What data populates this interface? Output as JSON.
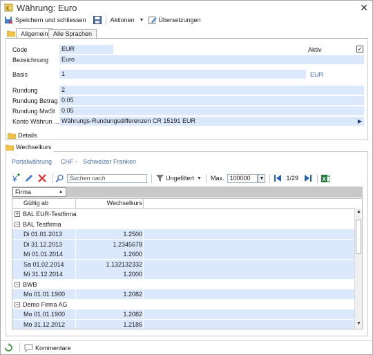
{
  "window": {
    "title": "Währung: Euro"
  },
  "toolbar": {
    "save_close": "Speichern und schliessen",
    "actions": "Aktionen",
    "translations": "Übersetzungen"
  },
  "tabs": [
    {
      "label": "Allgemein"
    },
    {
      "label": "Alle Sprachen"
    }
  ],
  "form": {
    "code_label": "Code",
    "code_value": "EUR",
    "aktiv_label": "Aktiv",
    "aktiv_checked": true,
    "aktiv_check": "✓",
    "bezeichnung_label": "Bezeichnung",
    "bezeichnung_value": "Euro",
    "basis_label": "Basis",
    "basis_value": "1",
    "basis_unit": "EUR",
    "rundung_label": "Rundung",
    "rundung_value": "2",
    "rundung_betrag_label": "Rundung Betrag",
    "rundung_betrag_value": "0.05",
    "rundung_mwst_label": "Rundung MwSt",
    "rundung_mwst_value": "0.05",
    "konto_label": "Konto Währun ...",
    "konto_value": "Währungs-Rundungsdifferenzen CR 15191 EUR"
  },
  "details": {
    "label": "Details"
  },
  "wechselkurs": {
    "tab_label": "Wechselkurs",
    "portal_label": "Portalwährung",
    "portal_code": "CHF",
    "portal_sep": "-",
    "portal_name": "Schweizer Franken",
    "search_placeholder": "Suchen nach",
    "filter_label": "Ungefiltert",
    "max_label": "Max.",
    "max_value": "100000",
    "page": "1/29",
    "group_chip": "Firma",
    "col_gueltig": "Gültig ab",
    "col_kurs": "Wechselkurs",
    "rows": [
      {
        "kind": "group",
        "toggle": "+",
        "text": "BAL EUR-Testfirma"
      },
      {
        "kind": "group",
        "toggle": "−",
        "text": "BAL Testfirma"
      },
      {
        "kind": "data",
        "date": "Di 01.01.2013",
        "rate": "1.2500"
      },
      {
        "kind": "data",
        "date": "Di 31.12.2013",
        "rate": "1.2345678"
      },
      {
        "kind": "data",
        "date": "Mi 01.01.2014",
        "rate": "1.2600"
      },
      {
        "kind": "data",
        "date": "Sa 01.02.2014",
        "rate": "1.132132332"
      },
      {
        "kind": "data",
        "date": "Mi 31.12.2014",
        "rate": "1.2000"
      },
      {
        "kind": "group",
        "toggle": "−",
        "text": "BWB"
      },
      {
        "kind": "data",
        "date": "Mo 01.01.1900",
        "rate": "1.2082"
      },
      {
        "kind": "group",
        "toggle": "−",
        "text": "Demo Firma AG"
      },
      {
        "kind": "data",
        "date": "Mo 01.01.1900",
        "rate": "1.2082"
      },
      {
        "kind": "data",
        "date": "Mo 31.12.2012",
        "rate": "1.2185"
      }
    ]
  },
  "status": {
    "comments": "Kommentare"
  },
  "colors": {
    "field_bg": "#dce8fb",
    "accent": "#1f5fb4"
  }
}
